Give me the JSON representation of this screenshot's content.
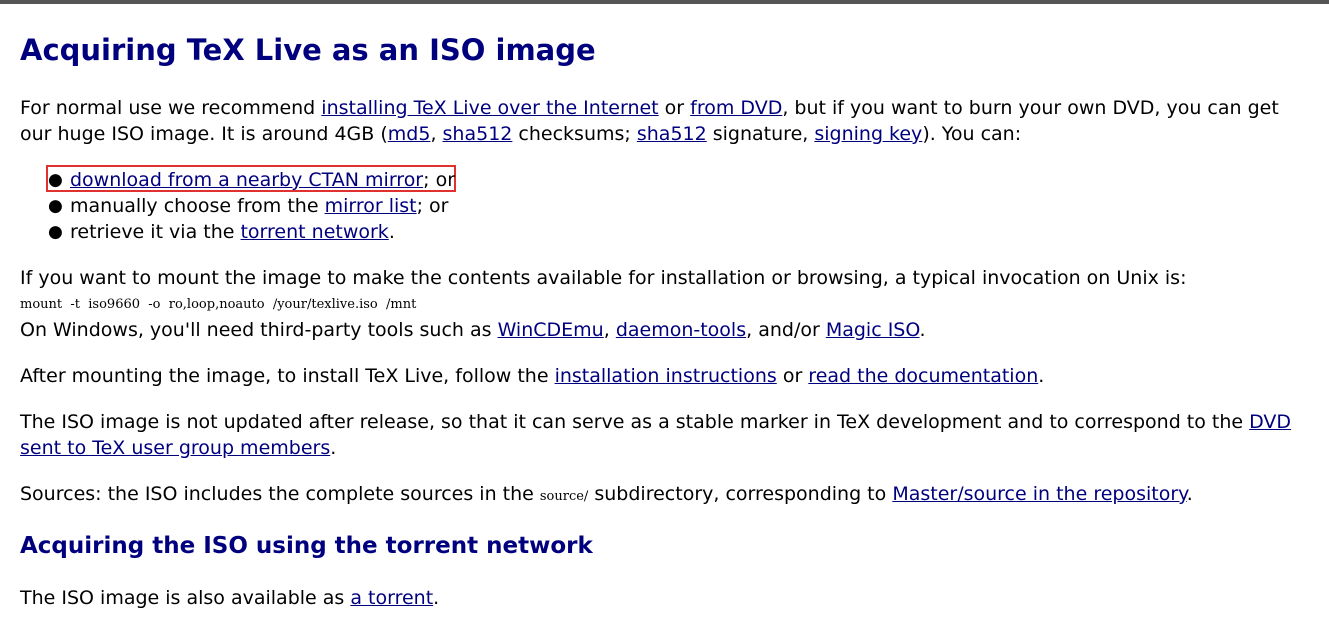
{
  "h1": "Acquiring TeX Live as an ISO image",
  "p1": {
    "t1": "For normal use we recommend ",
    "l1": "installing TeX Live over the Internet",
    "t2": " or ",
    "l2": "from DVD",
    "t3": ", but if you want to burn your own DVD, you can get",
    "t4": "our huge ISO image. It is around 4GB (",
    "l3": "md5",
    "t5": ", ",
    "l4": "sha512",
    "t6": " checksums; ",
    "l5": "sha512",
    "t7": " signature, ",
    "l6": "signing key",
    "t8": "). You can:"
  },
  "list": {
    "i1_link": "download from a nearby CTAN mirror",
    "i1_tail": "; or",
    "i2_text": "manually choose from the ",
    "i2_link": "mirror list",
    "i2_tail": "; or",
    "i3_text": "retrieve it via the ",
    "i3_link": "torrent network",
    "i3_tail": "."
  },
  "p2": {
    "t1": "If you want to mount the image to make the contents available for installation or browsing, a typical invocation on Unix is:",
    "code": "mount  -t  iso9660  -o  ro,loop,noauto  /your/texlive.iso  /mnt",
    "t2": "On Windows, you'll need third-party tools such as ",
    "l1": "WinCDEmu",
    "t3": ", ",
    "l2": "daemon-tools",
    "t4": ", and/or ",
    "l3": "Magic ISO",
    "t5": "."
  },
  "p3": {
    "t1": "After mounting the image, to install TeX Live, follow the ",
    "l1": "installation instructions",
    "t2": " or ",
    "l2": "read the documentation",
    "t3": "."
  },
  "p4": {
    "t1": "The ISO image is not updated after release, so that it can serve as a stable marker in TeX development and to correspond to the ",
    "l1a": "DVD",
    "l1b": "sent to TeX user group members",
    "t2": "."
  },
  "p5": {
    "t1": "Sources: the ISO includes the complete sources in the ",
    "code": "source/",
    "t2": " subdirectory, corresponding to ",
    "l1": "Master/source in the repository",
    "t3": "."
  },
  "h2": "Acquiring the ISO using the torrent network",
  "p6": {
    "t1": "The ISO image is also available as ",
    "l1": "a torrent",
    "t2": "."
  }
}
